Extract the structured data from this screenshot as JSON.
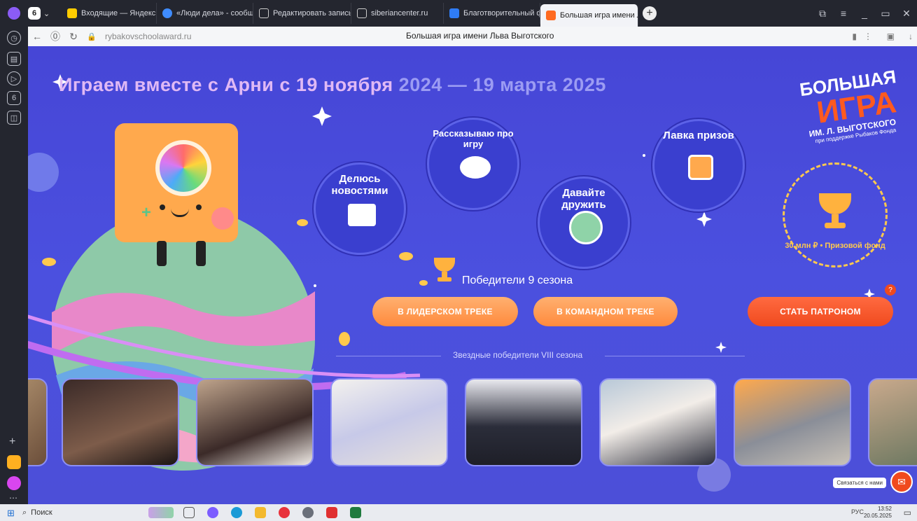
{
  "browser": {
    "tabs": [
      {
        "label": "Входящие — Яндекс Почт",
        "color": "#ffcc00"
      },
      {
        "label": "«Люди дела» - сообществ",
        "color": "#3f8cff"
      },
      {
        "label": "Редактировать запись «",
        "color": "#e6e6e6"
      },
      {
        "label": "siberiancenter.ru",
        "color": "#e6e6e6"
      },
      {
        "label": "Благотворительный фонд",
        "color": "#2f7cf6"
      },
      {
        "label": "Большая игра имени Л",
        "color": "#ff6a20",
        "active": true
      }
    ],
    "url": "rybakovschoolaward.ru",
    "page_title": "Большая игра имени Льва Выготского"
  },
  "page": {
    "headline_main": "Играем вместе с Арни с 19 ноября",
    "headline_dates": " 2024 — 19 марта 2025",
    "circles": [
      {
        "label": "Делюсь новостями",
        "icon": "envelope-icon"
      },
      {
        "label": "Рассказываю про игру",
        "icon": "thought-bubble-icon"
      },
      {
        "label": "Давайте дружить",
        "icon": "friends-group-icon"
      },
      {
        "label": "Лавка призов",
        "icon": "gift-box-icon"
      }
    ],
    "logo": {
      "line1": "БОЛЬШАЯ",
      "line2": "ИГРА",
      "line3": "ИМ. Л. ВЫГОТСКОГО",
      "line4": "при поддержке Рыбаков Фонда"
    },
    "prize_text": "30 млн ₽ • Призовой фонд",
    "winners_title": "Победители 9 сезона",
    "buttons": {
      "leader_track": "В ЛИДЕРСКОМ ТРЕКЕ",
      "team_track": "В КОМАНДНОМ ТРЕКЕ",
      "patron": "СТАТЬ ПАТРОНОМ"
    },
    "star_winners_title": "Звездные победители VIII сезона",
    "help_badge": "?",
    "contact_label": "Связаться с нами"
  },
  "taskbar": {
    "search_placeholder": "Поиск",
    "lang": "РУС",
    "time": "13:52",
    "date": "20.05.2025"
  },
  "colors": {
    "background": "#4b50df",
    "accent_orange": "#ff8a3c",
    "accent_red": "#f04a1e"
  }
}
